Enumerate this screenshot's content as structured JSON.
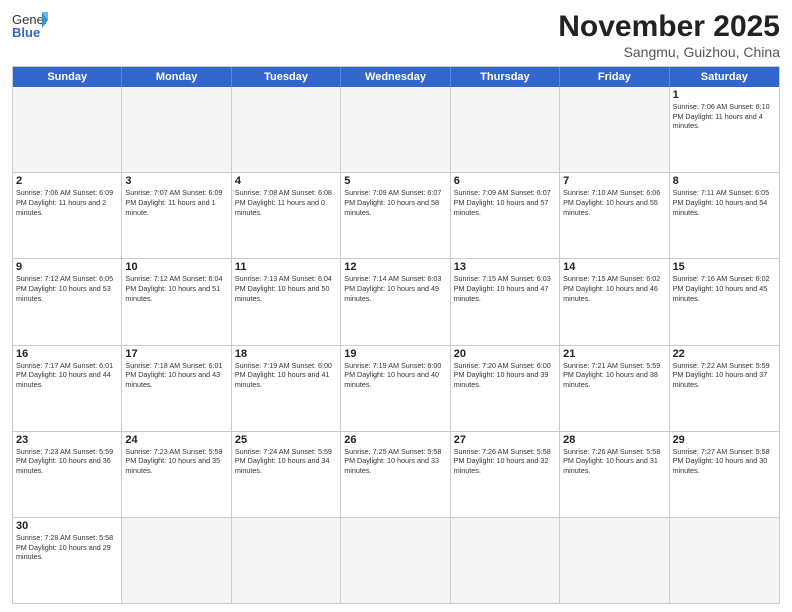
{
  "header": {
    "logo_general": "General",
    "logo_blue": "Blue",
    "month_title": "November 2025",
    "location": "Sangmu, Guizhou, China"
  },
  "days_of_week": [
    "Sunday",
    "Monday",
    "Tuesday",
    "Wednesday",
    "Thursday",
    "Friday",
    "Saturday"
  ],
  "weeks": [
    [
      {
        "day": "",
        "info": ""
      },
      {
        "day": "",
        "info": ""
      },
      {
        "day": "",
        "info": ""
      },
      {
        "day": "",
        "info": ""
      },
      {
        "day": "",
        "info": ""
      },
      {
        "day": "",
        "info": ""
      },
      {
        "day": "1",
        "info": "Sunrise: 7:06 AM\nSunset: 6:10 PM\nDaylight: 11 hours and 4 minutes."
      }
    ],
    [
      {
        "day": "2",
        "info": "Sunrise: 7:06 AM\nSunset: 6:09 PM\nDaylight: 11 hours and 2 minutes."
      },
      {
        "day": "3",
        "info": "Sunrise: 7:07 AM\nSunset: 6:09 PM\nDaylight: 11 hours and 1 minute."
      },
      {
        "day": "4",
        "info": "Sunrise: 7:08 AM\nSunset: 6:08 PM\nDaylight: 11 hours and 0 minutes."
      },
      {
        "day": "5",
        "info": "Sunrise: 7:09 AM\nSunset: 6:07 PM\nDaylight: 10 hours and 58 minutes."
      },
      {
        "day": "6",
        "info": "Sunrise: 7:09 AM\nSunset: 6:07 PM\nDaylight: 10 hours and 57 minutes."
      },
      {
        "day": "7",
        "info": "Sunrise: 7:10 AM\nSunset: 6:06 PM\nDaylight: 10 hours and 55 minutes."
      },
      {
        "day": "8",
        "info": "Sunrise: 7:11 AM\nSunset: 6:05 PM\nDaylight: 10 hours and 54 minutes."
      }
    ],
    [
      {
        "day": "9",
        "info": "Sunrise: 7:12 AM\nSunset: 6:05 PM\nDaylight: 10 hours and 53 minutes."
      },
      {
        "day": "10",
        "info": "Sunrise: 7:12 AM\nSunset: 6:04 PM\nDaylight: 10 hours and 51 minutes."
      },
      {
        "day": "11",
        "info": "Sunrise: 7:13 AM\nSunset: 6:04 PM\nDaylight: 10 hours and 50 minutes."
      },
      {
        "day": "12",
        "info": "Sunrise: 7:14 AM\nSunset: 6:03 PM\nDaylight: 10 hours and 49 minutes."
      },
      {
        "day": "13",
        "info": "Sunrise: 7:15 AM\nSunset: 6:03 PM\nDaylight: 10 hours and 47 minutes."
      },
      {
        "day": "14",
        "info": "Sunrise: 7:15 AM\nSunset: 6:02 PM\nDaylight: 10 hours and 46 minutes."
      },
      {
        "day": "15",
        "info": "Sunrise: 7:16 AM\nSunset: 6:02 PM\nDaylight: 10 hours and 45 minutes."
      }
    ],
    [
      {
        "day": "16",
        "info": "Sunrise: 7:17 AM\nSunset: 6:01 PM\nDaylight: 10 hours and 44 minutes."
      },
      {
        "day": "17",
        "info": "Sunrise: 7:18 AM\nSunset: 6:01 PM\nDaylight: 10 hours and 43 minutes."
      },
      {
        "day": "18",
        "info": "Sunrise: 7:19 AM\nSunset: 6:00 PM\nDaylight: 10 hours and 41 minutes."
      },
      {
        "day": "19",
        "info": "Sunrise: 7:19 AM\nSunset: 6:00 PM\nDaylight: 10 hours and 40 minutes."
      },
      {
        "day": "20",
        "info": "Sunrise: 7:20 AM\nSunset: 6:00 PM\nDaylight: 10 hours and 39 minutes."
      },
      {
        "day": "21",
        "info": "Sunrise: 7:21 AM\nSunset: 5:59 PM\nDaylight: 10 hours and 38 minutes."
      },
      {
        "day": "22",
        "info": "Sunrise: 7:22 AM\nSunset: 5:59 PM\nDaylight: 10 hours and 37 minutes."
      }
    ],
    [
      {
        "day": "23",
        "info": "Sunrise: 7:23 AM\nSunset: 5:59 PM\nDaylight: 10 hours and 36 minutes."
      },
      {
        "day": "24",
        "info": "Sunrise: 7:23 AM\nSunset: 5:59 PM\nDaylight: 10 hours and 35 minutes."
      },
      {
        "day": "25",
        "info": "Sunrise: 7:24 AM\nSunset: 5:59 PM\nDaylight: 10 hours and 34 minutes."
      },
      {
        "day": "26",
        "info": "Sunrise: 7:25 AM\nSunset: 5:58 PM\nDaylight: 10 hours and 33 minutes."
      },
      {
        "day": "27",
        "info": "Sunrise: 7:26 AM\nSunset: 5:58 PM\nDaylight: 10 hours and 32 minutes."
      },
      {
        "day": "28",
        "info": "Sunrise: 7:26 AM\nSunset: 5:58 PM\nDaylight: 10 hours and 31 minutes."
      },
      {
        "day": "29",
        "info": "Sunrise: 7:27 AM\nSunset: 5:58 PM\nDaylight: 10 hours and 30 minutes."
      }
    ],
    [
      {
        "day": "30",
        "info": "Sunrise: 7:28 AM\nSunset: 5:58 PM\nDaylight: 10 hours and 29 minutes."
      },
      {
        "day": "",
        "info": ""
      },
      {
        "day": "",
        "info": ""
      },
      {
        "day": "",
        "info": ""
      },
      {
        "day": "",
        "info": ""
      },
      {
        "day": "",
        "info": ""
      },
      {
        "day": "",
        "info": ""
      }
    ]
  ]
}
